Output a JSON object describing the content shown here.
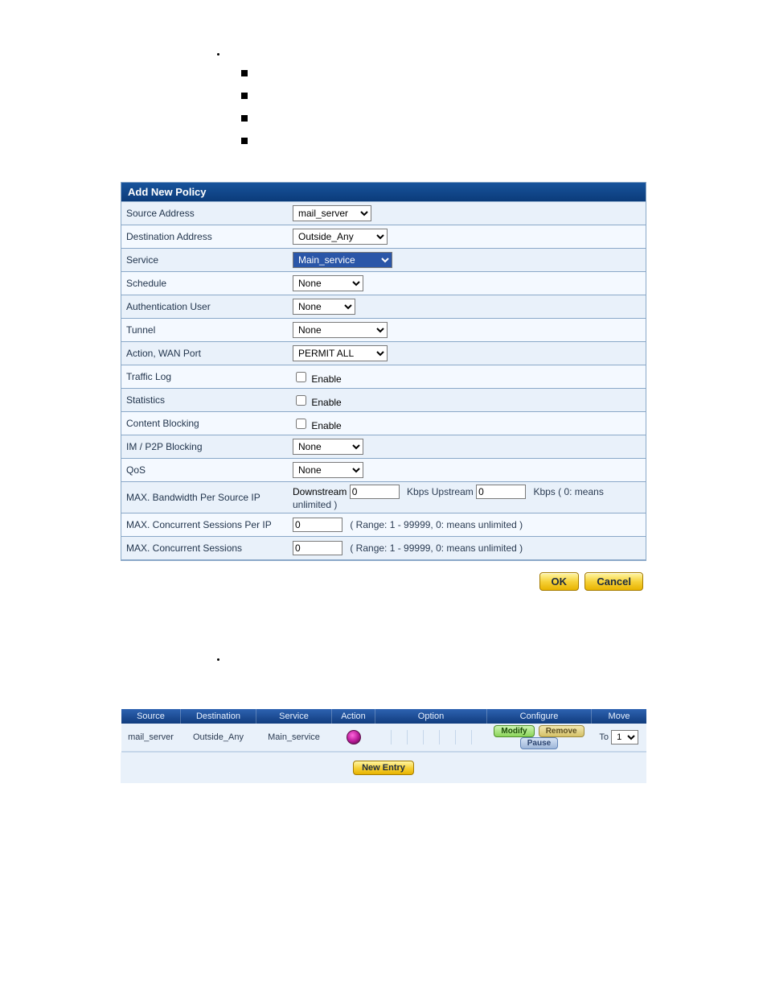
{
  "form": {
    "title": "Add New Policy",
    "rows": {
      "source_address": {
        "label": "Source Address",
        "value": "mail_server"
      },
      "destination_address": {
        "label": "Destination Address",
        "value": "Outside_Any"
      },
      "service": {
        "label": "Service",
        "value": "Main_service"
      },
      "schedule": {
        "label": "Schedule",
        "value": "None"
      },
      "auth_user": {
        "label": "Authentication User",
        "value": "None"
      },
      "tunnel": {
        "label": "Tunnel",
        "value": "None"
      },
      "action_wan": {
        "label": "Action, WAN Port",
        "value": "PERMIT ALL"
      },
      "traffic_log": {
        "label": "Traffic Log",
        "option": "Enable"
      },
      "statistics": {
        "label": "Statistics",
        "option": "Enable"
      },
      "content_blocking": {
        "label": "Content Blocking",
        "option": "Enable"
      },
      "im_p2p": {
        "label": "IM / P2P Blocking",
        "value": "None"
      },
      "qos": {
        "label": "QoS",
        "value": "None"
      },
      "max_bw": {
        "label": "MAX. Bandwidth Per Source IP",
        "down_label": "Downstream",
        "down_value": "0",
        "up_label": "Kbps Upstream",
        "up_value": "0",
        "hint": "Kbps ( 0: means unlimited )"
      },
      "max_sess_ip": {
        "label": "MAX. Concurrent Sessions Per IP",
        "value": "0",
        "hint": "( Range: 1 - 99999, 0: means unlimited )"
      },
      "max_sess": {
        "label": "MAX. Concurrent Sessions",
        "value": "0",
        "hint": "( Range: 1 - 99999, 0: means unlimited )"
      }
    },
    "buttons": {
      "ok": "OK",
      "cancel": "Cancel"
    }
  },
  "list": {
    "headers": {
      "source": "Source",
      "destination": "Destination",
      "service": "Service",
      "action": "Action",
      "option": "Option",
      "configure": "Configure",
      "move": "Move"
    },
    "row": {
      "source": "mail_server",
      "destination": "Outside_Any",
      "service": "Main_service",
      "move_label": "To",
      "move_value": "1"
    },
    "configure_buttons": {
      "modify": "Modify",
      "remove": "Remove",
      "pause": "Pause"
    },
    "new_entry": "New Entry"
  }
}
